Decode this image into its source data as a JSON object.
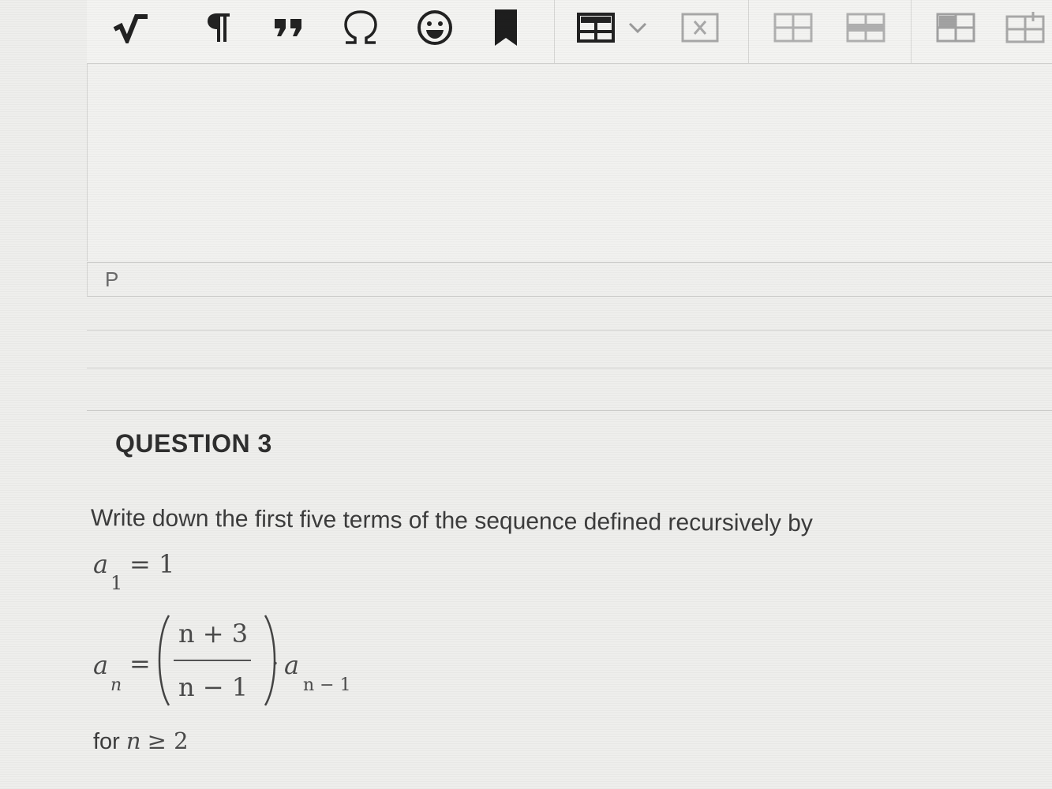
{
  "toolbar": {
    "icons": [
      "square-root-icon",
      "paragraph-icon",
      "blockquote-icon",
      "omega-icon",
      "emoji-icon",
      "bookmark-icon",
      "table-icon",
      "dropdown-chevron-icon",
      "delete-table-icon",
      "table-cell-icon",
      "table-row-icon",
      "table-merge-icon",
      "table-insert-icon"
    ]
  },
  "editor": {
    "path_label": "P"
  },
  "question": {
    "title": "QUESTION 3",
    "prompt": "Write down the first five terms of the sequence defined recursively by",
    "formula1": {
      "var": "a",
      "sub": "1",
      "rest": "= 1"
    },
    "formula2": {
      "var": "a",
      "sub": "n",
      "eq": "=",
      "numerator": "n + 3",
      "denominator": "n − 1",
      "dot": "·",
      "var2": "a",
      "sub2": "n − 1"
    },
    "condition": {
      "word": "for",
      "var": "n",
      "rest": "≥ 2"
    }
  }
}
